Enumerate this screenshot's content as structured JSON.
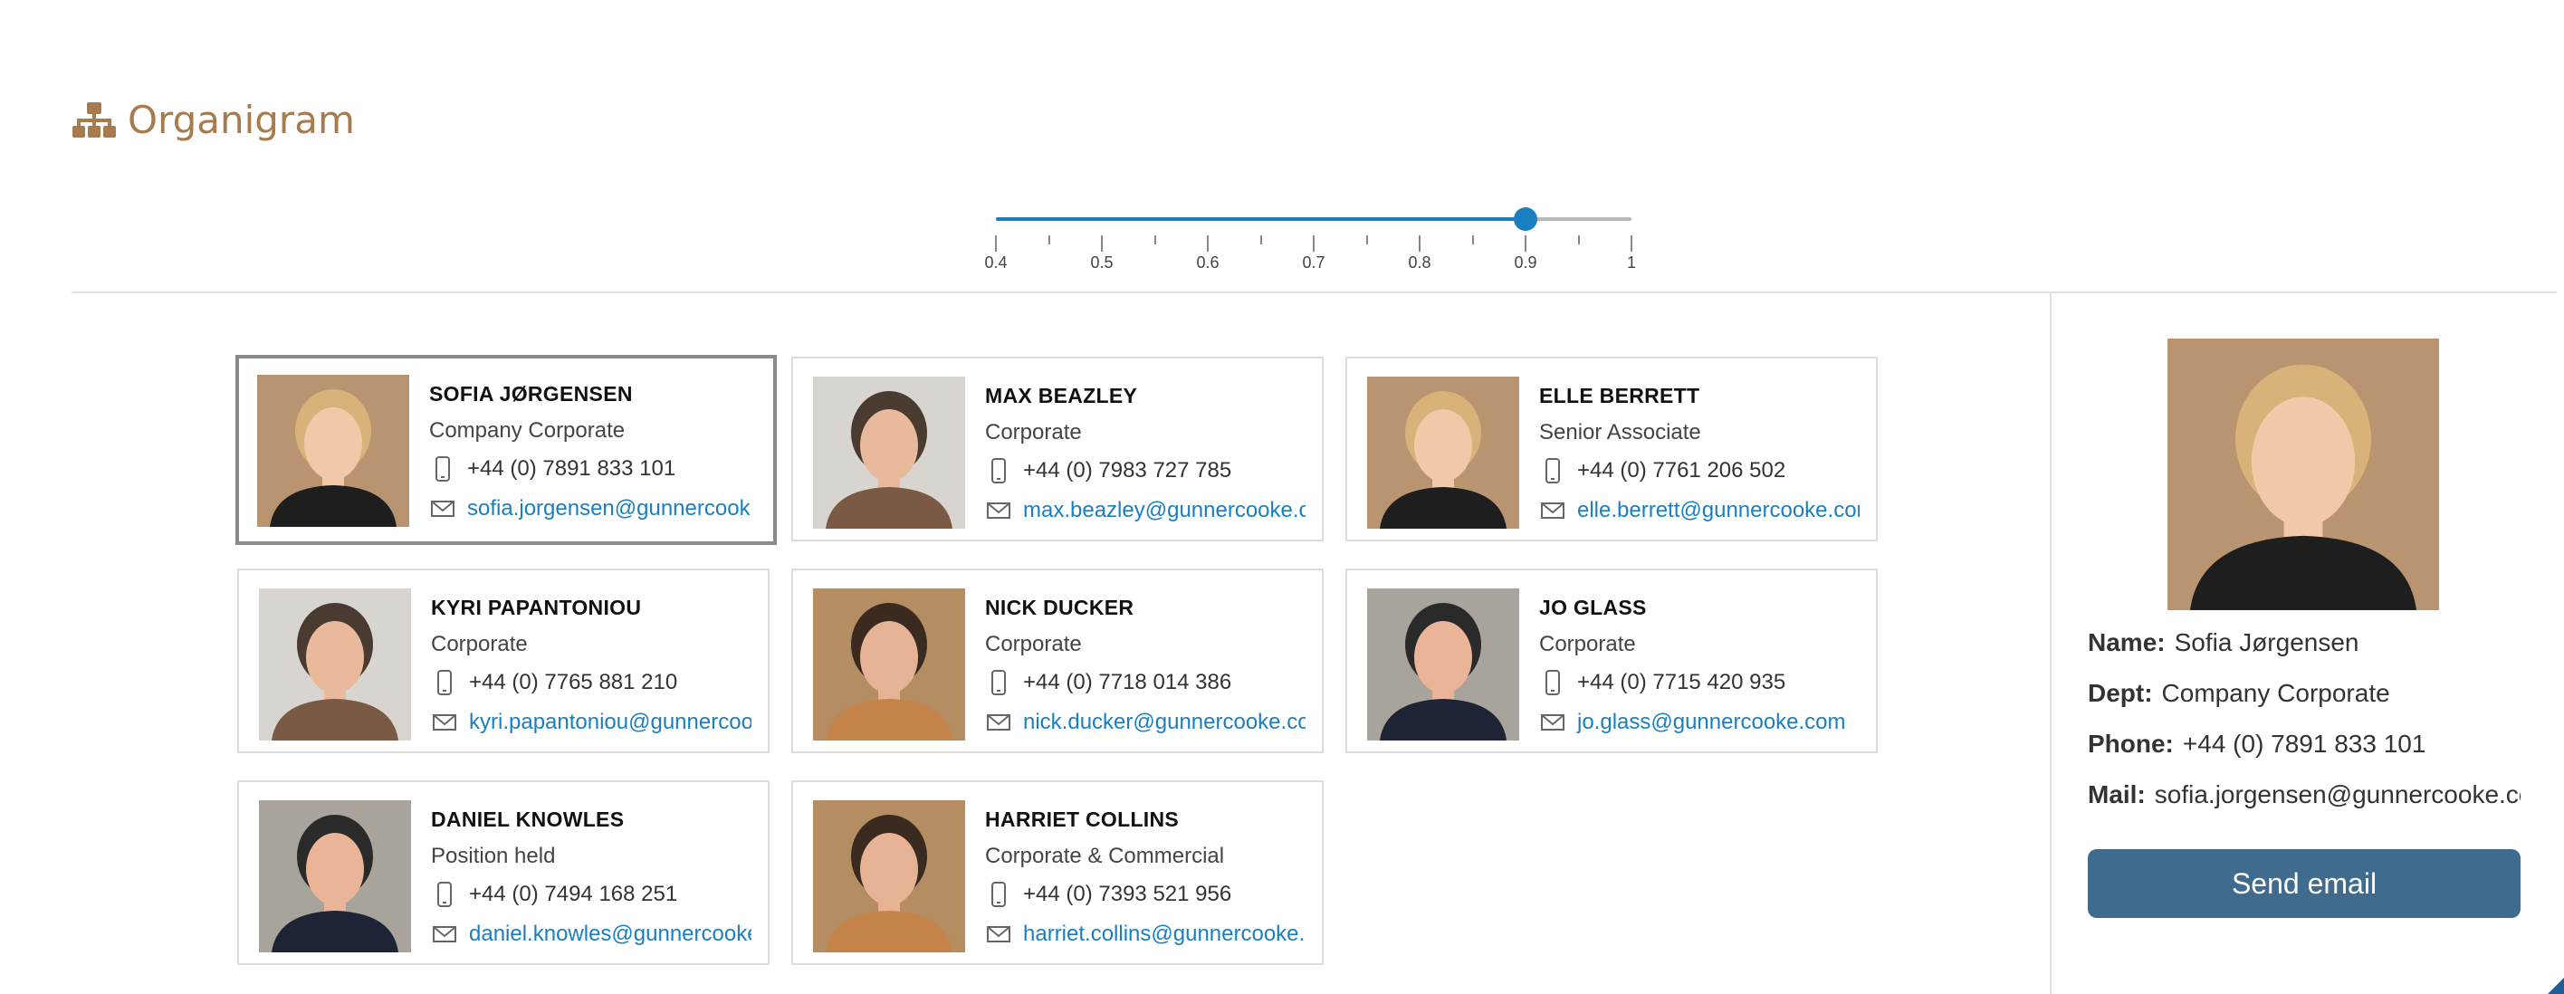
{
  "header": {
    "title": "Organigram",
    "icon": "org-chart-icon",
    "color": "#a67c4e"
  },
  "slider": {
    "value": 0.9,
    "min": 0.4,
    "max": 1,
    "tick_labels": [
      "0.4",
      "0.5",
      "0.6",
      "0.7",
      "0.8",
      "0.9",
      "1"
    ],
    "accent": "#1a7fc1"
  },
  "people": [
    {
      "name": "SOFIA JØRGENSEN",
      "dept": "Company Corporate",
      "phone": "+44 (0) 7891 833 101",
      "email": "sofia.jorgensen@gunnercooke.com",
      "selected": true,
      "palette": "fair"
    },
    {
      "name": "MAX BEAZLEY",
      "dept": "Corporate",
      "phone": "+44 (0) 7983 727 785",
      "email": "max.beazley@gunnercooke.com",
      "selected": false,
      "palette": "grey"
    },
    {
      "name": "ELLE BERRETT",
      "dept": "Senior Associate",
      "phone": "+44 (0) 7761 206 502",
      "email": "elle.berrett@gunnercooke.com",
      "selected": false,
      "palette": "fair"
    },
    {
      "name": "KYRI PAPANTONIOU",
      "dept": "Corporate",
      "phone": "+44 (0) 7765 881 210",
      "email": "kyri.papantoniou@gunnercooke.com",
      "selected": false,
      "palette": "grey"
    },
    {
      "name": "NICK DUCKER",
      "dept": "Corporate",
      "phone": "+44 (0) 7718 014 386",
      "email": "nick.ducker@gunnercooke.com",
      "selected": false,
      "palette": "warm"
    },
    {
      "name": "JO GLASS",
      "dept": "Corporate",
      "phone": "+44 (0) 7715 420 935",
      "email": "jo.glass@gunnercooke.com",
      "selected": false,
      "palette": "suit"
    },
    {
      "name": "DANIEL KNOWLES",
      "dept": "Position held",
      "phone": "+44 (0) 7494 168 251",
      "email": "daniel.knowles@gunnercooke.com",
      "selected": false,
      "palette": "suit"
    },
    {
      "name": "HARRIET COLLINS",
      "dept": "Corporate & Commercial",
      "phone": "+44 (0) 7393 521 956",
      "email": "harriet.collins@gunnercooke.com",
      "selected": false,
      "palette": "warm"
    }
  ],
  "detail": {
    "name_label": "Name:",
    "name": "Sofia Jørgensen",
    "dept_label": "Dept:",
    "dept": "Company Corporate",
    "phone_label": "Phone:",
    "phone": "+44 (0) 7891 833 101",
    "mail_label": "Mail:",
    "mail": "sofia.jorgensen@gunnercooke.com",
    "button": "Send email",
    "button_color": "#3f6b8e"
  }
}
